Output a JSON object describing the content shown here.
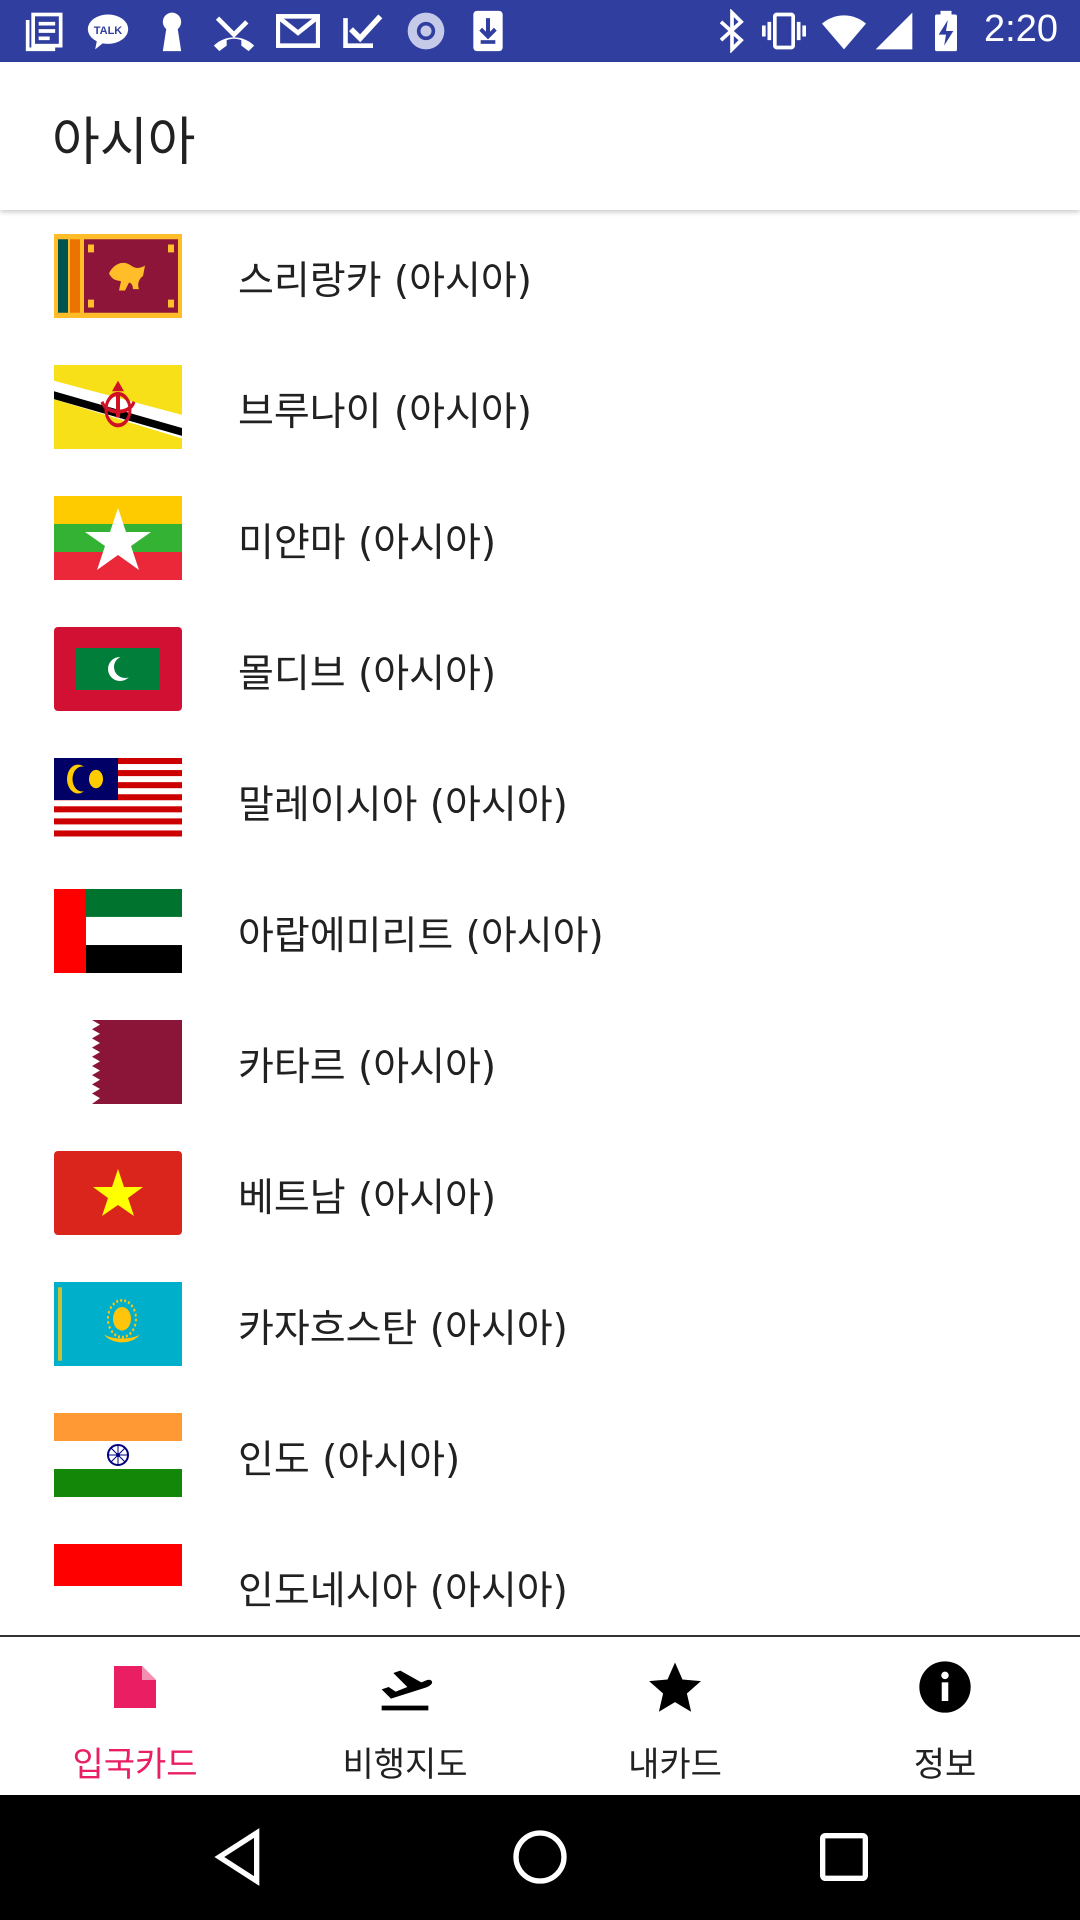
{
  "status_bar": {
    "time": "2:20",
    "left_icons": [
      "notes-icon",
      "kakaotalk-icon",
      "keyhole-icon",
      "missed-call-icon",
      "gmail-icon",
      "tasks-icon",
      "record-icon",
      "download-icon"
    ],
    "right_icons": [
      "bluetooth-icon",
      "vibrate-icon",
      "wifi-icon",
      "signal-icon",
      "battery-charging-icon"
    ],
    "color": "#303f9f"
  },
  "app_bar": {
    "title": "아시아"
  },
  "countries": [
    {
      "label": "스리랑카 (아시아)",
      "flag": "sri-lanka"
    },
    {
      "label": "브루나이 (아시아)",
      "flag": "brunei"
    },
    {
      "label": "미얀마 (아시아)",
      "flag": "myanmar"
    },
    {
      "label": "몰디브 (아시아)",
      "flag": "maldives"
    },
    {
      "label": "말레이시아 (아시아)",
      "flag": "malaysia"
    },
    {
      "label": "아랍에미리트 (아시아)",
      "flag": "uae"
    },
    {
      "label": "카타르 (아시아)",
      "flag": "qatar"
    },
    {
      "label": "베트남 (아시아)",
      "flag": "vietnam"
    },
    {
      "label": "카자흐스탄 (아시아)",
      "flag": "kazakhstan"
    },
    {
      "label": "인도 (아시아)",
      "flag": "india"
    },
    {
      "label": "인도네시아 (아시아)",
      "flag": "indonesia"
    }
  ],
  "bottom_nav": {
    "active_color": "#e91e63",
    "tabs": [
      {
        "label": "입국카드",
        "icon": "card-icon",
        "active": true
      },
      {
        "label": "비행지도",
        "icon": "flight-takeoff-icon",
        "active": false
      },
      {
        "label": "내카드",
        "icon": "star-icon",
        "active": false
      },
      {
        "label": "정보",
        "icon": "info-icon",
        "active": false
      }
    ]
  },
  "system_nav": {
    "buttons": [
      "back-icon",
      "home-icon",
      "recents-icon"
    ]
  }
}
